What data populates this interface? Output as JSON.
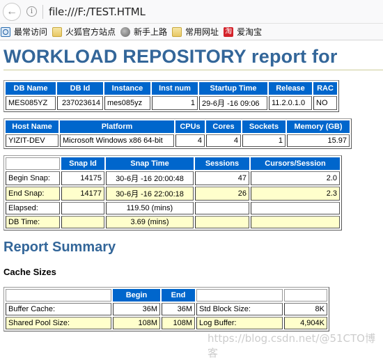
{
  "browser": {
    "url": "file:///F:/TEST.HTML",
    "bookmarks": [
      {
        "label": "最常访问",
        "icon": "search-icon"
      },
      {
        "label": "火狐官方站点",
        "icon": "folder-icon"
      },
      {
        "label": "新手上路",
        "icon": "globe-icon"
      },
      {
        "label": "常用网址",
        "icon": "folder-icon"
      },
      {
        "label": "爱淘宝",
        "icon": "taobao-icon",
        "glyph": "淘"
      }
    ]
  },
  "report": {
    "title": "WORKLOAD REPOSITORY report for",
    "db_table": {
      "headers": [
        "DB Name",
        "DB Id",
        "Instance",
        "Inst num",
        "Startup Time",
        "Release",
        "RAC"
      ],
      "row": [
        "MES085YZ",
        "237023614",
        "mes085yz",
        "1",
        "29-6月 -16 09:06",
        "11.2.0.1.0",
        "NO"
      ]
    },
    "host_table": {
      "headers": [
        "Host Name",
        "Platform",
        "CPUs",
        "Cores",
        "Sockets",
        "Memory (GB)"
      ],
      "row": [
        "YIZIT-DEV",
        "Microsoft Windows x86 64-bit",
        "4",
        "4",
        "1",
        "15.97"
      ]
    },
    "snap_table": {
      "headers": [
        "",
        "Snap Id",
        "Snap Time",
        "Sessions",
        "Cursors/Session"
      ],
      "rows": [
        [
          "Begin Snap:",
          "14175",
          "30-6月 -16 20:00:48",
          "47",
          "2.0"
        ],
        [
          "End Snap:",
          "14177",
          "30-6月 -16 22:00:18",
          "26",
          "2.3"
        ],
        [
          "Elapsed:",
          "",
          "119.50 (mins)",
          "",
          ""
        ],
        [
          "DB Time:",
          "",
          "3.69 (mins)",
          "",
          ""
        ]
      ]
    },
    "summary_heading": "Report Summary",
    "cache_heading": "Cache Sizes",
    "cache_table": {
      "headers": [
        "",
        "Begin",
        "End",
        "",
        ""
      ],
      "rows": [
        [
          "Buffer Cache:",
          "36M",
          "36M",
          "Std Block Size:",
          "8K"
        ],
        [
          "Shared Pool Size:",
          "108M",
          "108M",
          "Log Buffer:",
          "4,904K"
        ]
      ]
    }
  },
  "watermark": "https://blog.csdn.net/@51CTO博客"
}
